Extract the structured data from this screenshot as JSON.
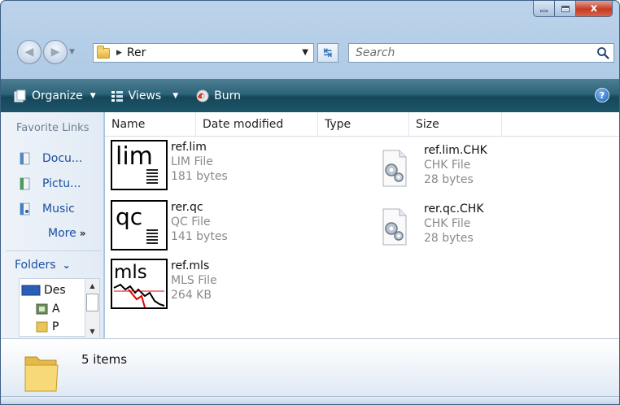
{
  "window": {
    "close_glyph": "x"
  },
  "address": {
    "crumb": "Rer",
    "search_placeholder": "Search"
  },
  "toolbar": {
    "organize": "Organize",
    "views": "Views",
    "burn": "Burn",
    "help": "?"
  },
  "navpane": {
    "favorites_header": "Favorite Links",
    "favorites": [
      {
        "label": "Docu...",
        "icon": "documents-icon"
      },
      {
        "label": "Pictu...",
        "icon": "pictures-icon"
      },
      {
        "label": "Music",
        "icon": "music-icon"
      }
    ],
    "more_label": "More",
    "more_glyph": "»",
    "folders_label": "Folders",
    "folders_glyph": "❯",
    "tree": [
      {
        "label": "Des"
      },
      {
        "label": "A"
      },
      {
        "label": "P"
      }
    ]
  },
  "columns": [
    "Name",
    "Date modified",
    "Type",
    "Size"
  ],
  "files": [
    {
      "name": "ref.lim",
      "type": "LIM File",
      "size": "181 bytes",
      "badge": "lim",
      "icon": "lim-file-icon"
    },
    {
      "name": "rer.qc",
      "type": "QC File",
      "size": "141 bytes",
      "badge": "qc",
      "icon": "qc-file-icon"
    },
    {
      "name": "ref.mls",
      "type": "MLS File",
      "size": "264 KB",
      "badge": "mls",
      "icon": "mls-file-icon"
    },
    {
      "name": "ref.lim.CHK",
      "type": "CHK File",
      "size": "28 bytes",
      "icon": "chk-file-icon"
    },
    {
      "name": "rer.qc.CHK",
      "type": "CHK File",
      "size": "28 bytes",
      "icon": "chk-file-icon"
    }
  ],
  "details": {
    "item_count": "5 items"
  },
  "colors": {
    "toolbar": "#1e5568",
    "link": "#1a4fa0",
    "accent_red": "#e00000"
  }
}
